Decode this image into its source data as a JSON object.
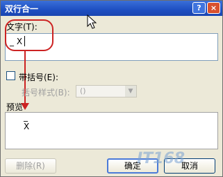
{
  "window": {
    "title": "双行合一"
  },
  "titlebar": {
    "help_label": "?",
    "close_label": "×"
  },
  "text_section": {
    "label": "文字(T):",
    "value": "_ X"
  },
  "brackets": {
    "checkbox_label": "带括号(E):",
    "checked": false,
    "style_label": "括号样式(B):",
    "style_value": "()"
  },
  "preview": {
    "label": "预览",
    "bar": "_",
    "text": "X"
  },
  "buttons": {
    "delete": "删除(R)",
    "ok": "确定",
    "cancel": "取消"
  },
  "watermark": {
    "text": "IT168"
  },
  "colors": {
    "titlebar": "#1e4fc2",
    "callout": "#cc2222"
  }
}
